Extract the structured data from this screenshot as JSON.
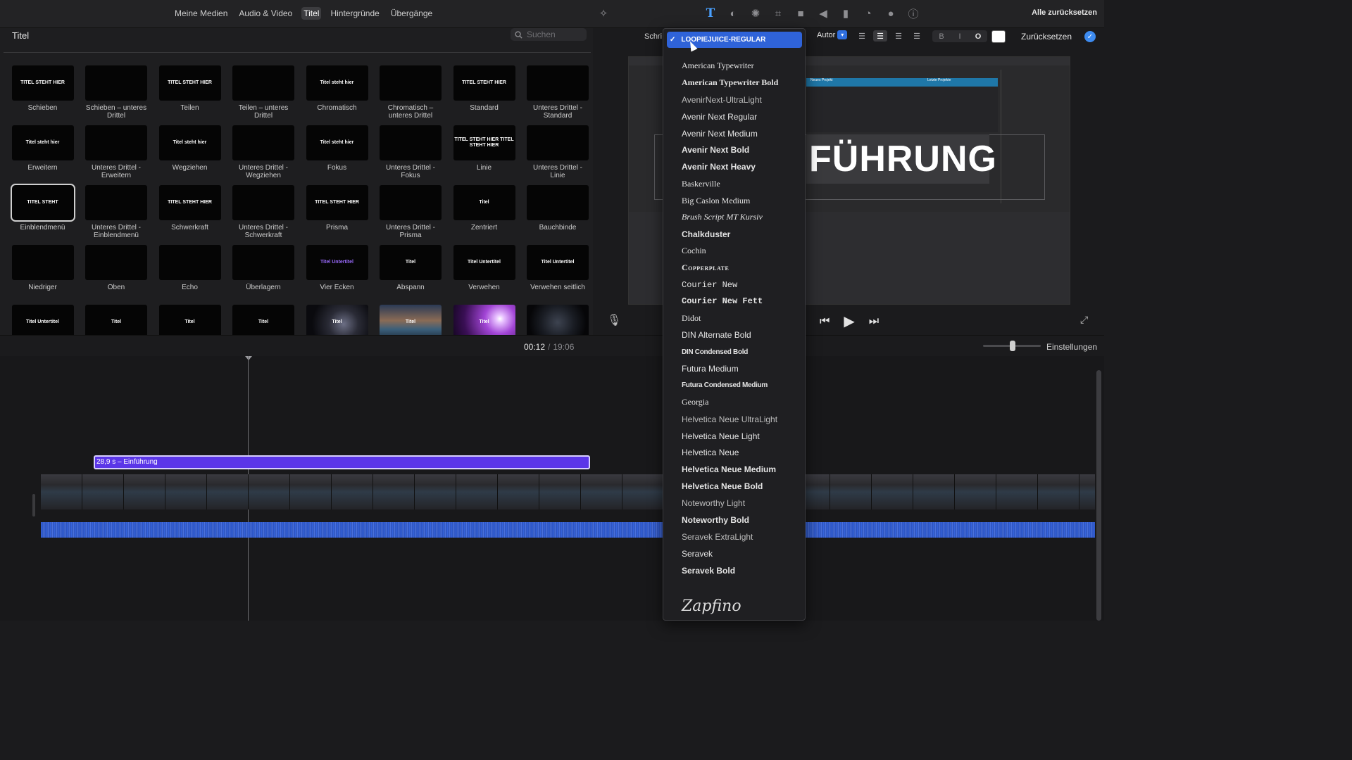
{
  "topbar": {
    "media_tabs": [
      "Meine Medien",
      "Audio & Video",
      "Titel",
      "Hintergründe",
      "Übergänge"
    ],
    "active_tab": "Titel",
    "reset_all": "Alle zurücksetzen",
    "tool_icons": [
      "magic-wand-icon",
      "text-icon",
      "color-balance-icon",
      "color-wheel-icon",
      "crop-icon",
      "camera-icon",
      "volume-icon",
      "equalizer-icon",
      "speed-icon",
      "overlay-icon",
      "info-icon"
    ]
  },
  "browser": {
    "title": "Titel",
    "search_placeholder": "Suchen",
    "tiles": [
      {
        "label": "Schieben",
        "thumb": "TITEL STEHT HIER"
      },
      {
        "label": "Schieben – unteres Drittel",
        "thumb": ""
      },
      {
        "label": "Teilen",
        "thumb": "TITEL STEHT HIER"
      },
      {
        "label": "Teilen – unteres Drittel",
        "thumb": ""
      },
      {
        "label": "Chromatisch",
        "thumb": "Titel steht hier"
      },
      {
        "label": "Chromatisch – unteres Drittel",
        "thumb": ""
      },
      {
        "label": "Standard",
        "thumb": "TITEL STEHT HIER"
      },
      {
        "label": "Unteres Drittel - Standard",
        "thumb": ""
      },
      {
        "label": "Erweitern",
        "thumb": "Titel steht hier"
      },
      {
        "label": "Unteres Drittel - Erweitern",
        "thumb": ""
      },
      {
        "label": "Wegziehen",
        "thumb": "Titel steht hier"
      },
      {
        "label": "Unteres Drittel - Wegziehen",
        "thumb": ""
      },
      {
        "label": "Fokus",
        "thumb": "Titel steht hier"
      },
      {
        "label": "Unteres Drittel - Fokus",
        "thumb": ""
      },
      {
        "label": "Linie",
        "thumb": "TITEL STEHT HIER TITEL STEHT HIER"
      },
      {
        "label": "Unteres Drittel - Linie",
        "thumb": ""
      },
      {
        "label": "Einblendmenü",
        "thumb": "TITEL STEHT"
      },
      {
        "label": "Unteres Drittel - Einblendmenü",
        "thumb": ""
      },
      {
        "label": "Schwerkraft",
        "thumb": "TITEL STEHT HIER"
      },
      {
        "label": "Unteres Drittel - Schwerkraft",
        "thumb": ""
      },
      {
        "label": "Prisma",
        "thumb": "TITEL STEHT HIER"
      },
      {
        "label": "Unteres Drittel - Prisma",
        "thumb": ""
      },
      {
        "label": "Zentriert",
        "thumb": "Titel"
      },
      {
        "label": "Bauchbinde",
        "thumb": ""
      },
      {
        "label": "Niedriger",
        "thumb": ""
      },
      {
        "label": "Oben",
        "thumb": ""
      },
      {
        "label": "Echo",
        "thumb": ""
      },
      {
        "label": "Überlagern",
        "thumb": ""
      },
      {
        "label": "Vier Ecken",
        "thumb": "Titel Untertitel"
      },
      {
        "label": "Abspann",
        "thumb": "Titel"
      },
      {
        "label": "Verwehen",
        "thumb": "Titel Untertitel"
      },
      {
        "label": "Verwehen seitlich",
        "thumb": "Titel Untertitel"
      },
      {
        "label": "",
        "thumb": "Titel Untertitel"
      },
      {
        "label": "",
        "thumb": "Titel"
      },
      {
        "label": "",
        "thumb": "Titel"
      },
      {
        "label": "",
        "thumb": "Titel"
      },
      {
        "label": "",
        "thumb": "Titel"
      },
      {
        "label": "",
        "thumb": "Titel"
      },
      {
        "label": "",
        "thumb": "Titel"
      },
      {
        "label": "",
        "thumb": ""
      }
    ]
  },
  "viewer": {
    "font_label": "Schri",
    "size_mode": "Autor",
    "style_buttons": [
      "B",
      "I",
      "O"
    ],
    "reset": "Zurücksetzen",
    "preview_big_text": "FÜHRUNG",
    "preview_panel1": "Neues Projekt",
    "preview_panel2": "Letzte Projekte"
  },
  "font_menu": {
    "selected": "LOOPIEJUICE-REGULAR",
    "items": [
      "American Typewriter",
      "American Typewriter Bold",
      "AvenirNext-UltraLight",
      "Avenir Next Regular",
      "Avenir Next Medium",
      "Avenir Next Bold",
      "Avenir Next Heavy",
      "Baskerville",
      "Big Caslon Medium",
      "Brush Script MT Kursiv",
      "Chalkduster",
      "Cochin",
      "Copperplate",
      "Courier New",
      "Courier New Fett",
      "Didot",
      "DIN Alternate Bold",
      "DIN Condensed Bold",
      "Futura Medium",
      "Futura Condensed Medium",
      "Georgia",
      "Helvetica Neue UltraLight",
      "Helvetica Neue Light",
      "Helvetica Neue",
      "Helvetica Neue Medium",
      "Helvetica Neue Bold",
      "Noteworthy Light",
      "Noteworthy Bold",
      "Seravek ExtraLight",
      "Seravek",
      "Seravek Bold"
    ],
    "last_item": "Zapfino"
  },
  "timeline": {
    "current_time": "00:12",
    "separator": "/",
    "total_time": "19:06",
    "settings": "Einstellungen",
    "title_clip": "28,9 s – Einführung"
  }
}
